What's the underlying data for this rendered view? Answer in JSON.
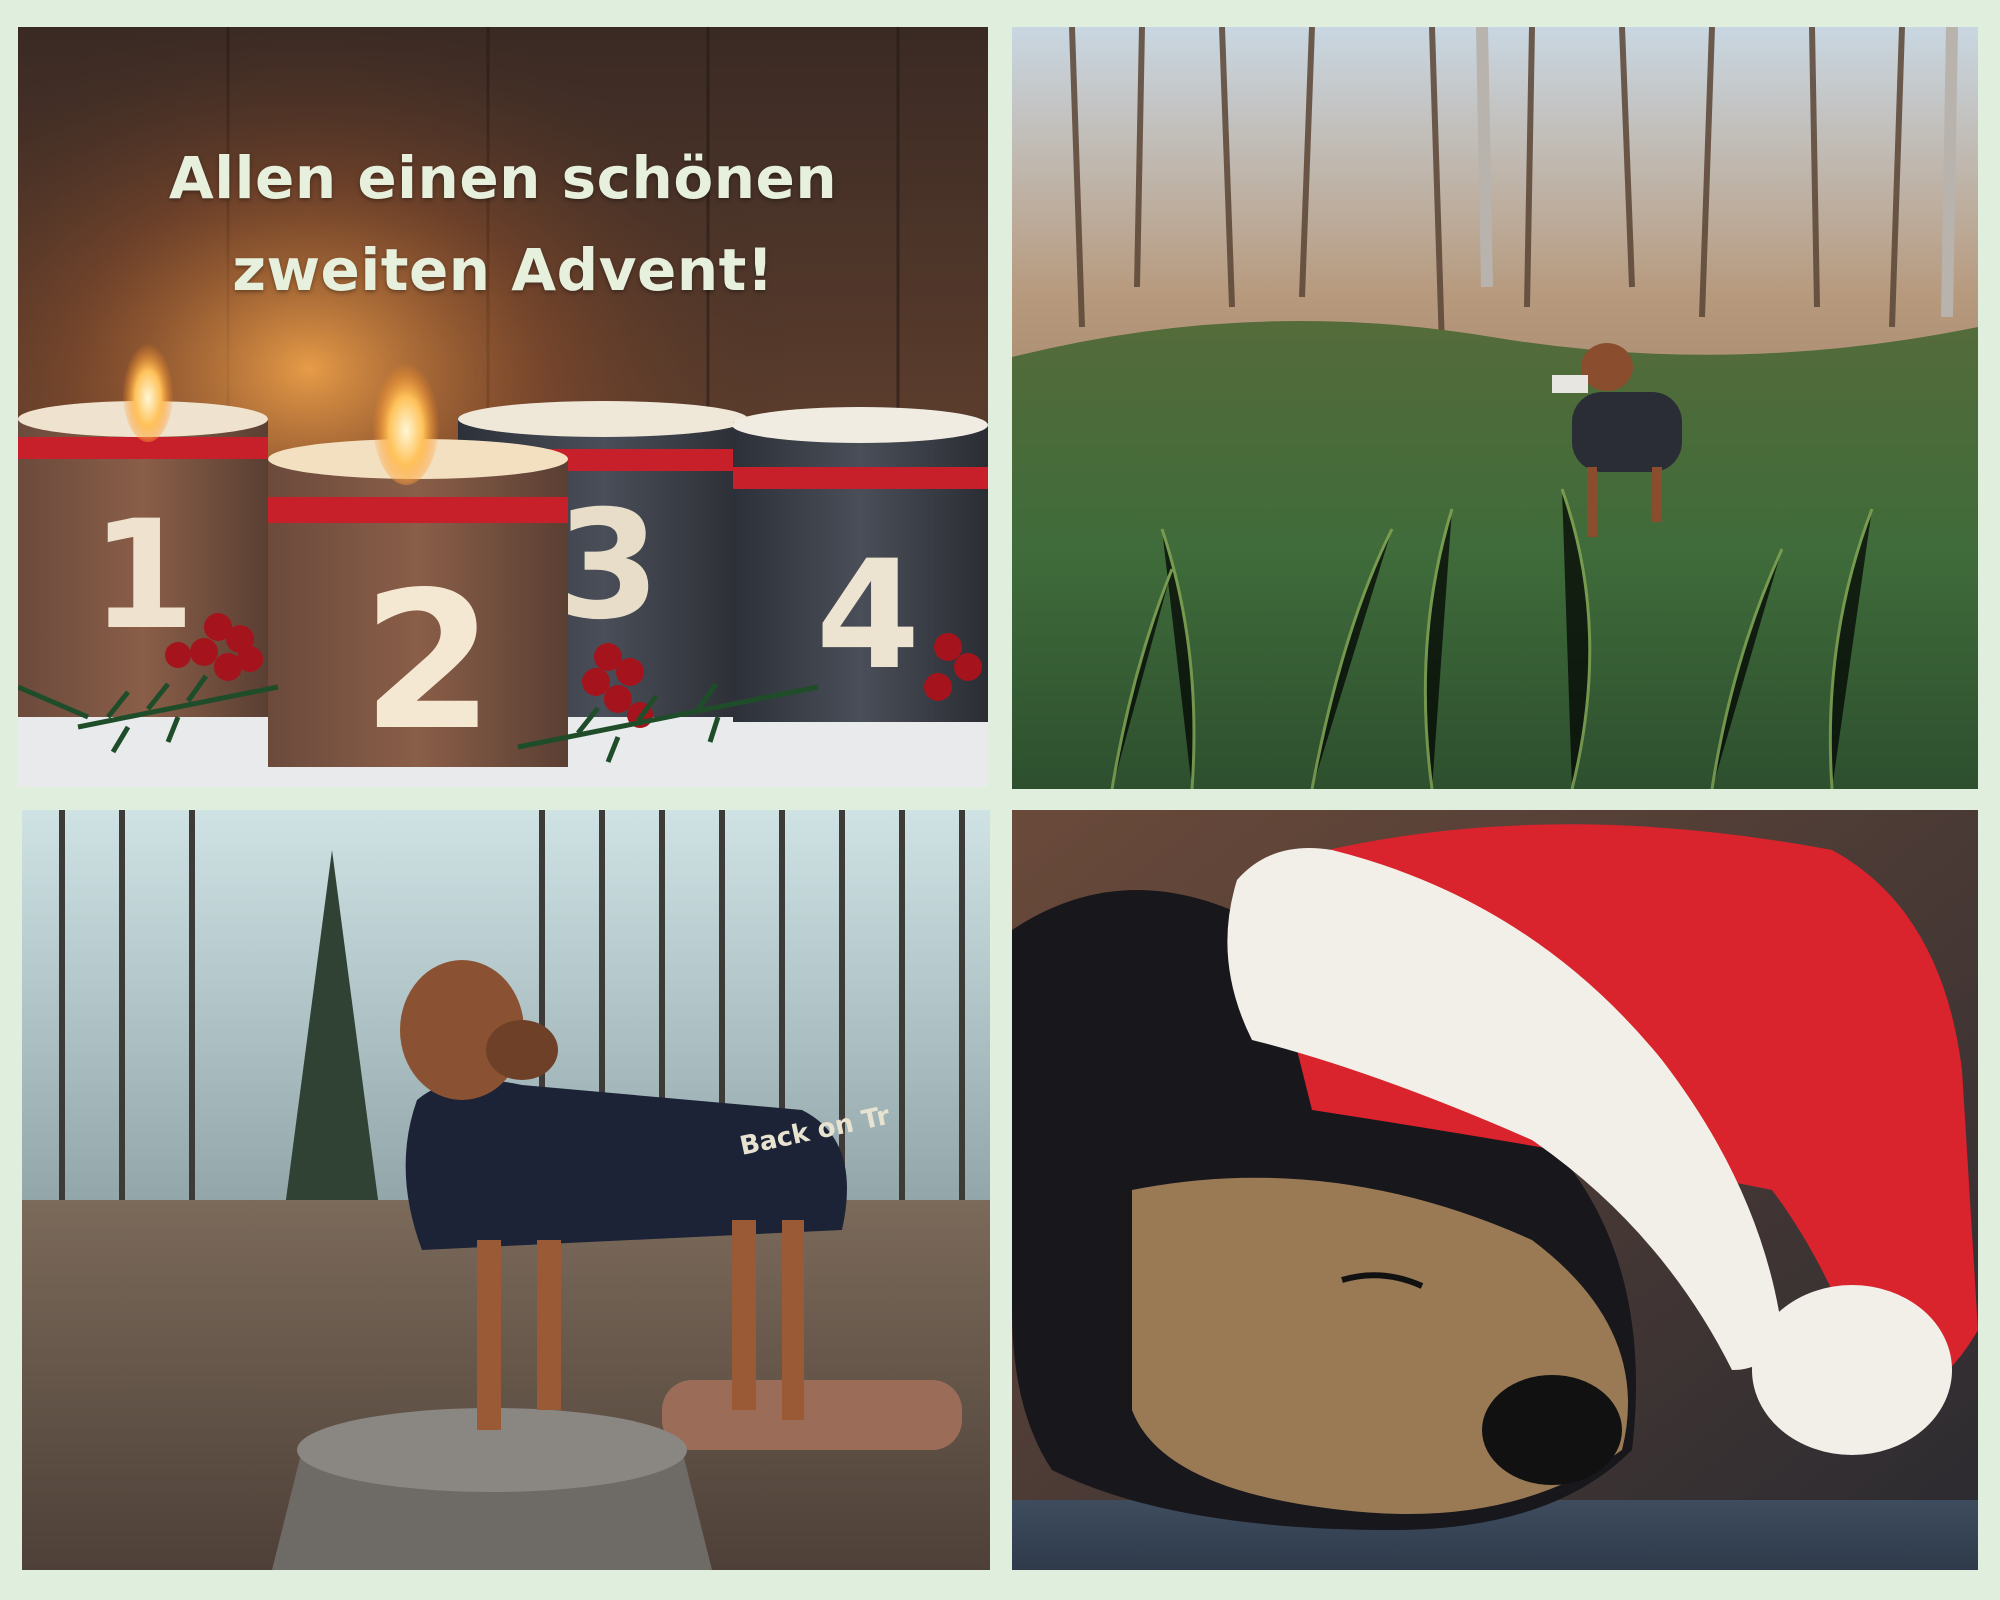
{
  "greeting": {
    "line1": "Allen einen schönen",
    "line2": "zweiten Advent!"
  },
  "candles": [
    "1",
    "2",
    "3",
    "4"
  ],
  "coat_text": "Back on Tr",
  "colors": {
    "background": "#dfeedd",
    "greeting_text": "#e6f0dc",
    "candle_band": "#c8202a",
    "hat_red": "#d9232d"
  }
}
